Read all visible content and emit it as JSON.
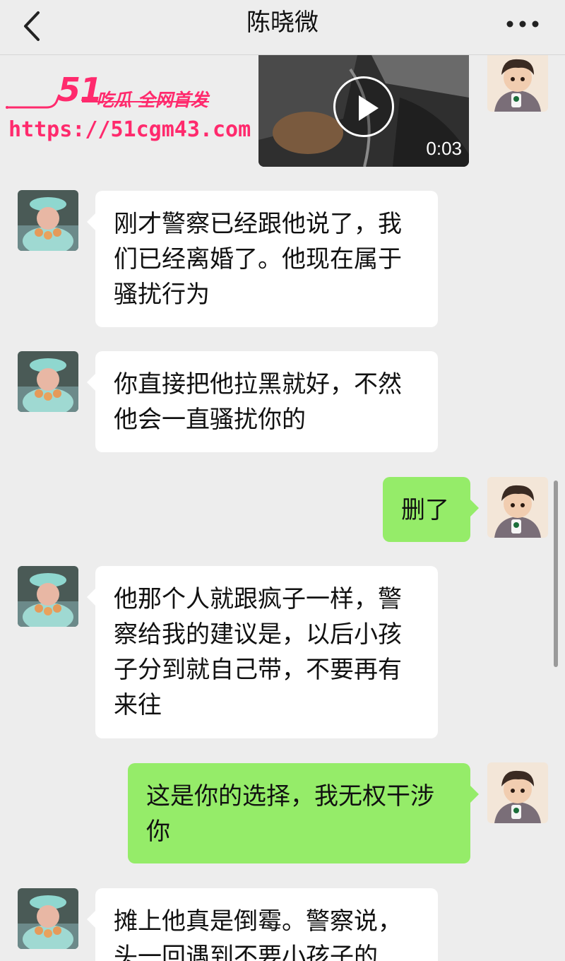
{
  "header": {
    "title": "陈晓微",
    "back_icon": "chevron-left-icon",
    "more_icon": "more-horizontal-icon"
  },
  "watermark": {
    "brand": "51",
    "tagline": "吃瓜 全网首发",
    "url": "https://51cgm43.com",
    "color": "#ff2a6d"
  },
  "video": {
    "duration": "0:03",
    "play_icon": "play-icon"
  },
  "messages": [
    {
      "from": "contact",
      "text_lines": [
        "刚才警察已经跟他说了，我",
        "们已经离婚了。他现在属于",
        "骚扰行为"
      ]
    },
    {
      "from": "contact",
      "text_lines": [
        "你直接把他拉黑就好，不然",
        "他会一直骚扰你的"
      ]
    },
    {
      "from": "me",
      "text_lines": [
        "删了"
      ]
    },
    {
      "from": "contact",
      "text_lines": [
        "他那个人就跟疯子一样，警",
        "察给我的建议是，以后小孩",
        "子分到就自己带，不要再有",
        "来往"
      ]
    },
    {
      "from": "me",
      "text_lines": [
        "这是你的选择，我无权干涉",
        "你"
      ]
    },
    {
      "from": "contact",
      "text_lines": [
        "摊上他真是倒霉。警察说，",
        "头一回遇到不要小孩子的"
      ]
    }
  ],
  "colors": {
    "background": "#ededed",
    "incoming_bubble": "#ffffff",
    "outgoing_bubble": "#95ec69"
  }
}
